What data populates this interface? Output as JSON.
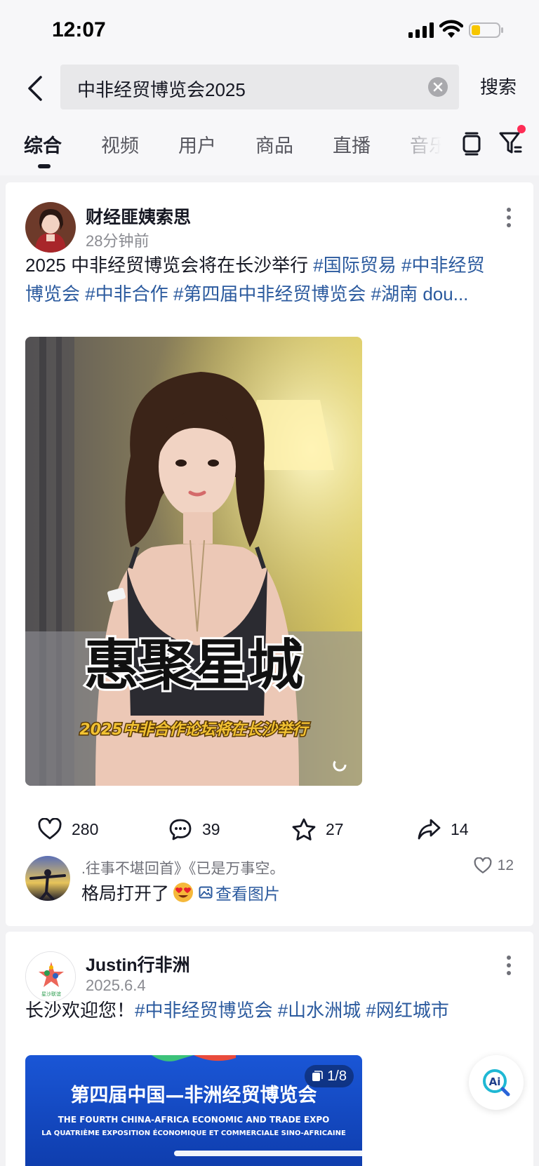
{
  "status_bar": {
    "time": "12:07"
  },
  "search": {
    "query": "中非经贸博览会2025",
    "search_label": "搜索"
  },
  "tabs": [
    "综合",
    "视频",
    "用户",
    "商品",
    "直播",
    "音乐"
  ],
  "posts": [
    {
      "author": "财经匪姨索思",
      "time": "28分钟前",
      "text_plain": "2025 中非经贸博览会将在长沙举行 ",
      "tags_line1": [
        "#国际贸易",
        "#中非经贸"
      ],
      "tags_line2": [
        "博览会",
        "#中非合作",
        "#第四届中非经贸博览会",
        "#湖南 dou..."
      ],
      "image_title": "惠聚星城",
      "image_subtitle": "2025中非合作论坛将在长沙举行",
      "likes": "280",
      "comments": "39",
      "favorites": "27",
      "shares": "14",
      "top_comment": {
        "user": ".往事不堪回首》《已是万事空。",
        "text": "格局打开了",
        "link": "查看图片",
        "likes": "12"
      }
    },
    {
      "author": "Justin行非洲",
      "time": "2025.6.4",
      "text_plain": "长沙欢迎您！",
      "tags": [
        "#中非经贸博览会",
        "#山水洲城",
        "#网红城市"
      ],
      "image_counter": "1/8",
      "image_title": "第四届中国—非洲经贸博览会",
      "image_sub_en": "THE FOURTH CHINA-AFRICA ECONOMIC AND TRADE EXPO",
      "image_sub_fr": "LA QUATRIÈME EXPOSITION ÉCONOMIQUE ET COMMERCIALE SINO-AFRICAINE",
      "avatar_label": "星沙联谊"
    }
  ],
  "ai_button": "Ai",
  "colors": {
    "tag": "#2b5a9e",
    "badge": "#fe2c55",
    "text": "#161823",
    "muted": "#8a8b91"
  }
}
